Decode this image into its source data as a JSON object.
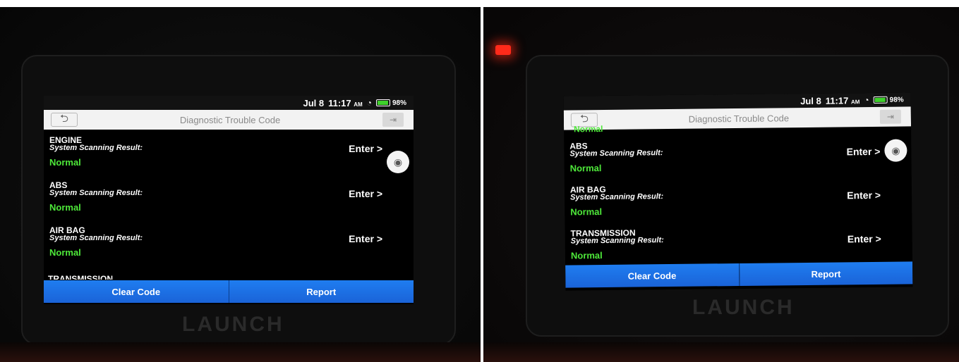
{
  "device_brand": "LAUNCH",
  "screens": [
    {
      "status": {
        "date": "Jul 8",
        "time": "11:17",
        "ampm": "AM",
        "battery": "98%"
      },
      "header": {
        "title": "Diagnostic Trouble Code"
      },
      "systems": [
        {
          "name": "ENGINE",
          "label": "System Scanning Result:",
          "value": "Normal",
          "enter": "Enter >"
        },
        {
          "name": "ABS",
          "label": "System Scanning Result:",
          "value": "Normal",
          "enter": "Enter >"
        },
        {
          "name": "AIR BAG",
          "label": "System Scanning Result:",
          "value": "Normal",
          "enter": "Enter >"
        }
      ],
      "clipped_next": "TRANSMISSION",
      "buttons": {
        "clear": "Clear Code",
        "report": "Report"
      }
    },
    {
      "status": {
        "date": "Jul 8",
        "time": "11:17",
        "ampm": "AM",
        "battery": "98%"
      },
      "header": {
        "title": "Diagnostic Trouble Code"
      },
      "clipped_prev": "Normal",
      "systems": [
        {
          "name": "ABS",
          "label": "System Scanning Result:",
          "value": "Normal",
          "enter": "Enter >"
        },
        {
          "name": "AIR BAG",
          "label": "System Scanning Result:",
          "value": "Normal",
          "enter": "Enter >"
        },
        {
          "name": "TRANSMISSION",
          "label": "System Scanning Result:",
          "value": "Normal",
          "enter": "Enter >"
        }
      ],
      "buttons": {
        "clear": "Clear Code",
        "report": "Report"
      }
    }
  ],
  "icons": {
    "back": "back-arrow-icon",
    "exit": "exit-icon",
    "wifi": "wifi-icon",
    "battery": "battery-icon",
    "camera": "camera-icon"
  },
  "colors": {
    "normal": "#4ee83a",
    "button": "#1f7df0",
    "title_bar": "#f2f2f2",
    "led": "#ff2a1a"
  }
}
